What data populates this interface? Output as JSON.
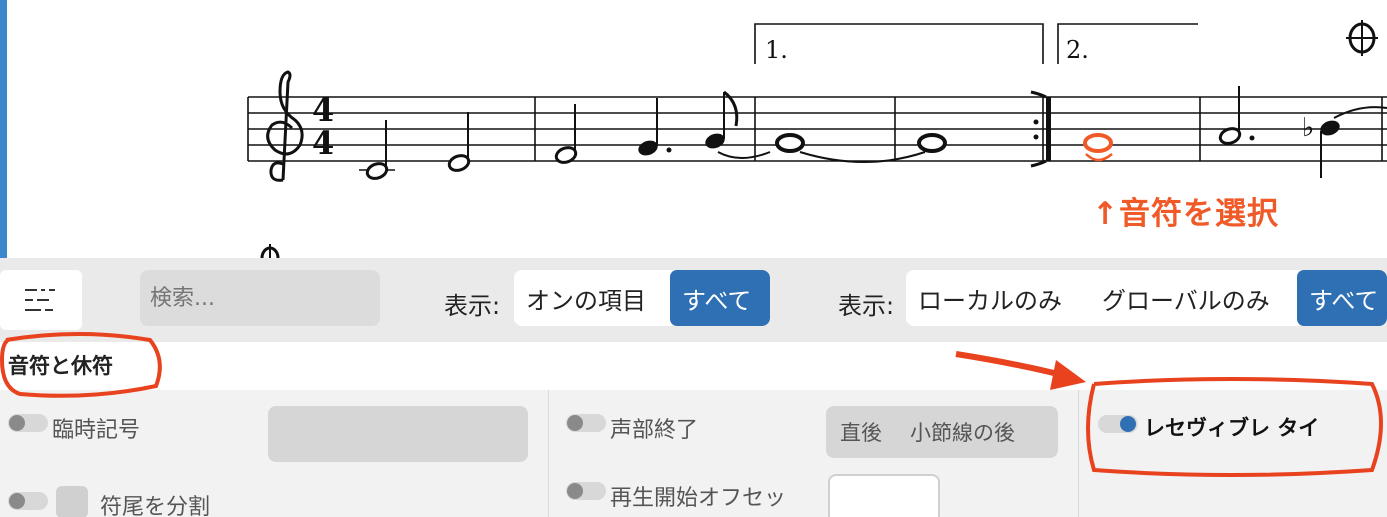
{
  "score": {
    "time_signature": {
      "top": "4",
      "bottom": "4"
    },
    "volta_1": "1.",
    "volta_2": "2.",
    "coda_symbol": "⌖",
    "annotation": "↑音符を選択",
    "colors": {
      "selected_note": "#f05a28",
      "edge": "#3a87cc"
    }
  },
  "toolbar": {
    "menu_icon": "list-icon",
    "search_placeholder": "検索...",
    "show_label_1": "表示:",
    "filter_1": {
      "options": [
        "オンの項目",
        "すべて"
      ],
      "selected": "すべて"
    },
    "show_label_2": "表示:",
    "filter_2": {
      "options": [
        "ローカルのみ",
        "グローバルのみ",
        "すべて"
      ],
      "selected": "すべて"
    },
    "accent": "#2f6fb4"
  },
  "section": {
    "title": "音符と休符"
  },
  "properties": {
    "col1": [
      {
        "label": "臨時記号"
      },
      {
        "label": "符尾を分割"
      }
    ],
    "col2": [
      {
        "label": "声部終了",
        "options": [
          "直後",
          "小節線の後"
        ]
      },
      {
        "label": "再生開始オフセッ"
      }
    ],
    "col3": [
      {
        "label": "レセヴィブレ タイ",
        "enabled": true
      }
    ]
  }
}
